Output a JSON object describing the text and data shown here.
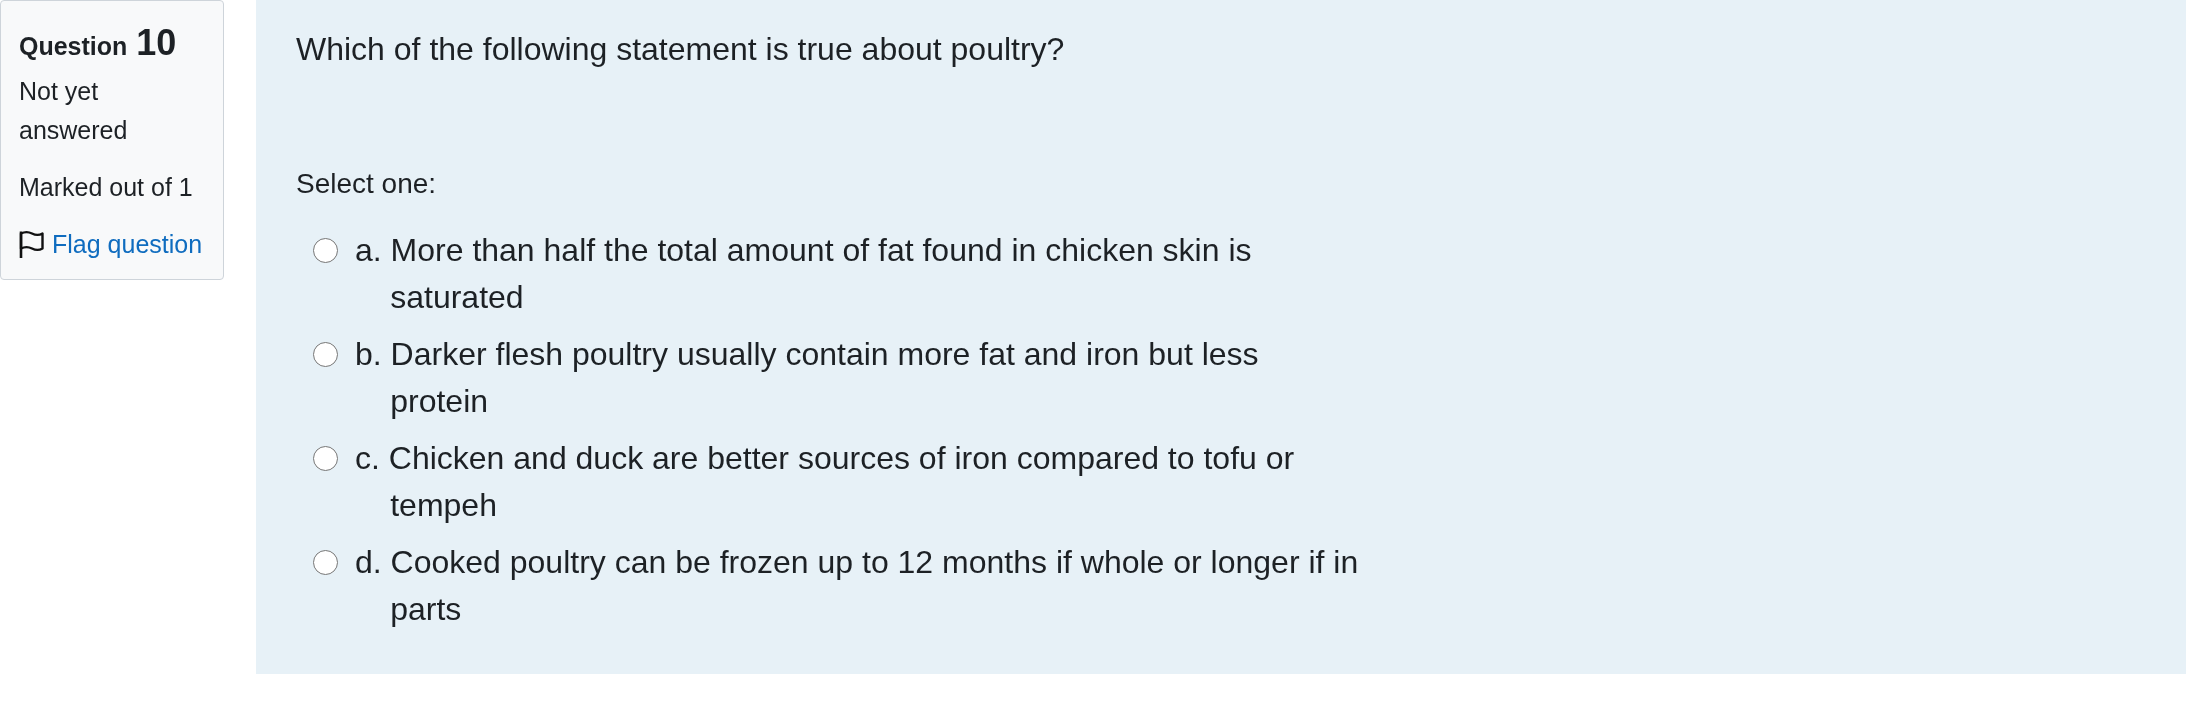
{
  "question_info": {
    "label": "Question",
    "number": "10",
    "state": "Not yet answered",
    "grade": "Marked out of 1",
    "flag": {
      "label": "Flag question",
      "flagged": false
    }
  },
  "question": {
    "text": "Which of the following statement is true about poultry?",
    "prompt": "Select one:",
    "options": [
      {
        "letter": "a.",
        "text": "More than half the total amount of fat found in chicken skin is saturated",
        "selected": false
      },
      {
        "letter": "b.",
        "text": "Darker flesh poultry usually contain more fat and iron but less protein",
        "selected": false
      },
      {
        "letter": "c.",
        "text": "Chicken and duck are better sources of iron compared to tofu or tempeh",
        "selected": false
      },
      {
        "letter": "d.",
        "text": "Cooked poultry can be frozen up to 12 months if whole or longer if in parts",
        "selected": false
      }
    ]
  }
}
